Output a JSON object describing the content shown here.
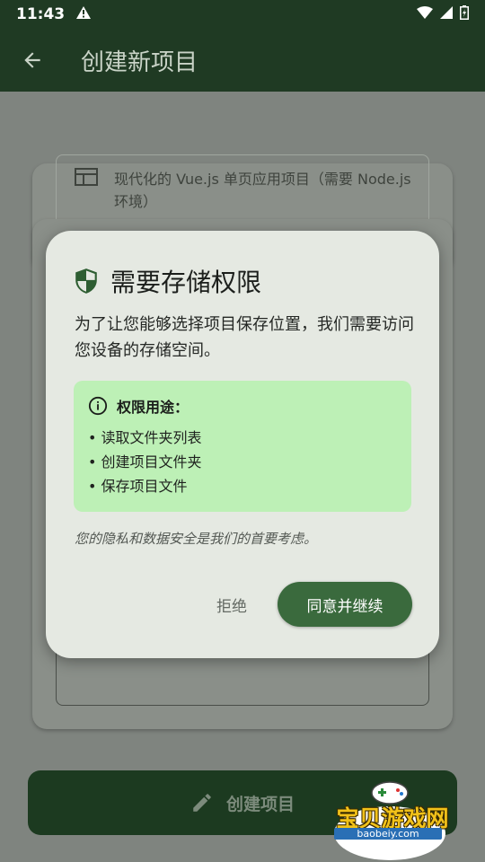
{
  "status_bar": {
    "time": "11:43",
    "icons": [
      "alert-icon",
      "wifi-icon",
      "signal-icon",
      "battery-icon"
    ]
  },
  "app_bar": {
    "title": "创建新项目",
    "back_icon": "arrow-back-icon"
  },
  "background": {
    "template_card": {
      "description": "现代化的 Vue.js 单页应用项目（需要 Node.js 环境）",
      "icon": "layout-icon"
    },
    "create_button": {
      "label": "创建项目",
      "icon": "pencil-icon"
    }
  },
  "dialog": {
    "title": "需要存储权限",
    "title_icon": "shield-icon",
    "message": "为了让您能够选择项目保存位置，我们需要访问您设备的存储空间。",
    "usage": {
      "heading": "权限用途：",
      "icon": "info-icon",
      "items": [
        "读取文件夹列表",
        "创建项目文件夹",
        "保存项目文件"
      ]
    },
    "privacy_note": "您的隐私和数据安全是我们的首要考虑。",
    "reject_label": "拒绝",
    "accept_label": "同意并继续"
  },
  "watermark": {
    "text": "宝贝游戏网",
    "url": "baobeiy.com"
  },
  "colors": {
    "app_bar": "#1f3a23",
    "dialog_bg": "#e5e9e2",
    "info_box": "#bdf0b6",
    "accept_button": "#3a6a3d"
  }
}
